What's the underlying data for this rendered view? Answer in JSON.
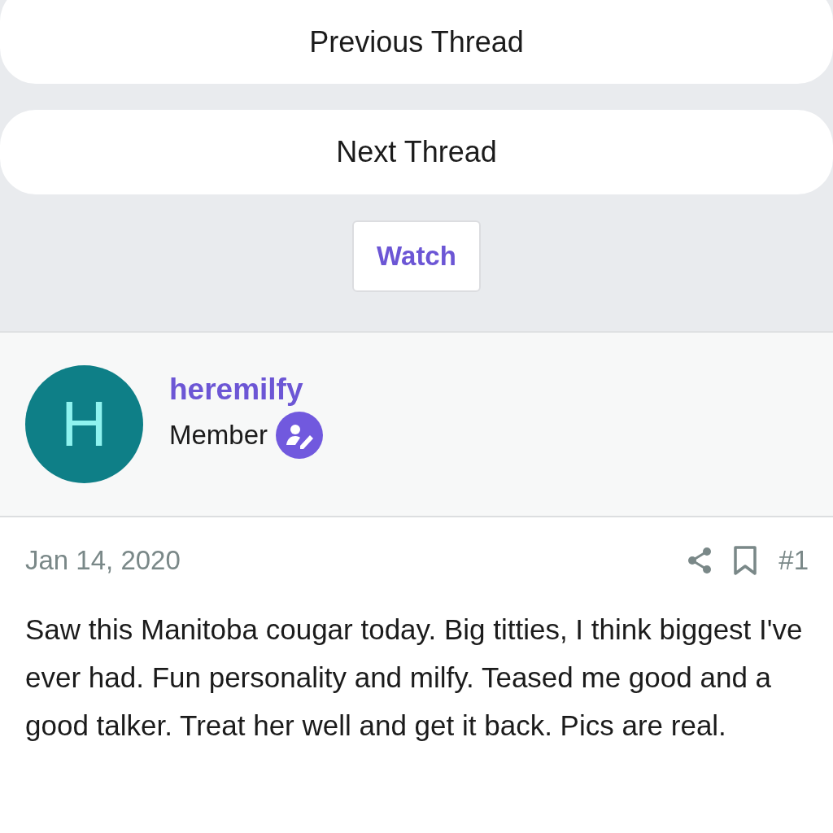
{
  "thread_nav": [
    {
      "label": "Previous Thread"
    },
    {
      "label": "Next Thread"
    }
  ],
  "watch_button": {
    "label": "Watch"
  },
  "post": {
    "author": {
      "initial": "H",
      "name": "heremilfy",
      "role": "Member"
    },
    "date": "Jan 14, 2020",
    "number": "#1",
    "body": "Saw this Manitoba cougar today. Big titties, I think biggest I've ever had. Fun personality and milfy. Teased me good and a good talker. Treat her well and get it back. Pics are real."
  }
}
